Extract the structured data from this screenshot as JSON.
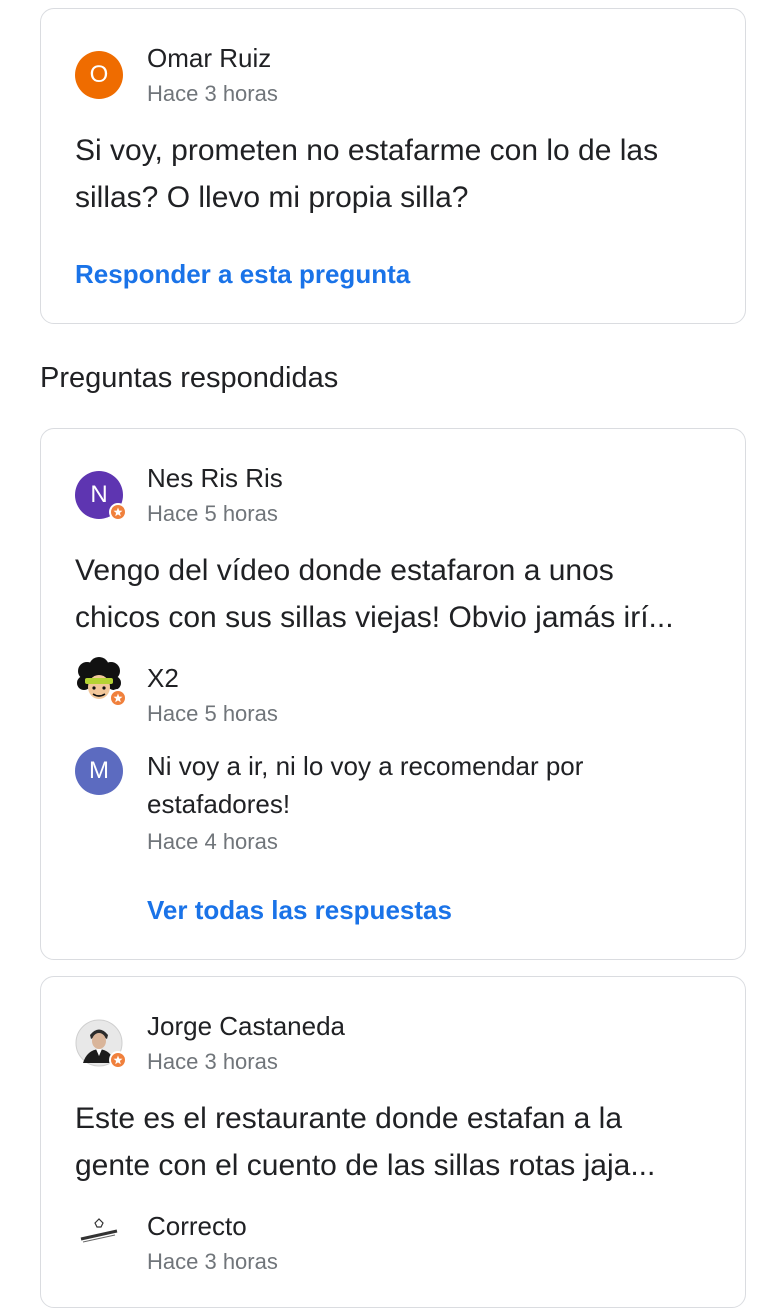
{
  "unanswered_question": {
    "author": "Omar Ruiz",
    "avatar_letter": "O",
    "avatar_color": "#ef6c00",
    "time": "Hace 3 horas",
    "text_line1": "Si voy, prometen no estafarme con lo de las",
    "text_line2": "sillas? O llevo mi propia silla?",
    "reply_link": "Responder a esta pregunta"
  },
  "answered_section_title": "Preguntas respondidas",
  "answered_questions": [
    {
      "author": "Nes Ris Ris",
      "avatar_letter": "N",
      "avatar_color": "#5e35b1",
      "time": "Hace 5 horas",
      "text_line1": "Vengo del vídeo donde estafaron a unos",
      "text_line2": "chicos con sus sillas viejas! Obvio jamás irí...",
      "answers": [
        {
          "author": "X2",
          "time": "Hace 5 horas",
          "avatar_icon": "afro-character-avatar"
        },
        {
          "avatar_letter": "M",
          "avatar_color": "#5c6bc0",
          "text_line1": "Ni voy a ir, ni lo voy a recomendar por",
          "text_line2": "estafadores!",
          "time": "Hace 4 horas"
        }
      ],
      "see_all_link": "Ver todas las respuestas"
    },
    {
      "author": "Jorge Castaneda",
      "avatar_icon": "profile-photo-avatar",
      "time": "Hace 3 horas",
      "text_line1": "Este es el restaurante donde estafan a la",
      "text_line2": "gente con el cuento de las sillas rotas jaja...",
      "answers": [
        {
          "author": "Correcto",
          "time": "Hace 3 horas",
          "avatar_icon": "logo-avatar"
        }
      ]
    }
  ],
  "colors": {
    "link": "#1a73e8",
    "secondary_text": "#70757a",
    "border": "#dadce0",
    "local_guide_badge": "#f0803c"
  }
}
